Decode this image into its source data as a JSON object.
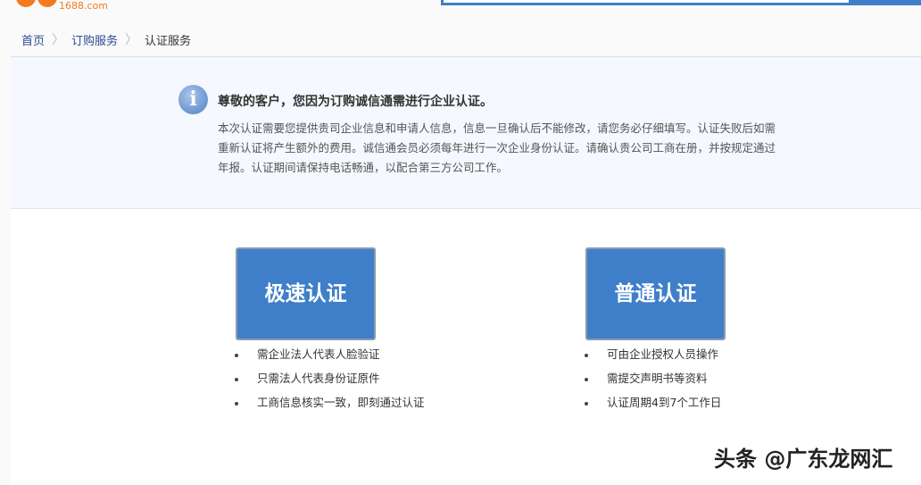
{
  "header": {
    "logo_text": "1688.com"
  },
  "breadcrumb": [
    "首页",
    "订购服务",
    "认证服务"
  ],
  "notice": {
    "title": "尊敬的客户，您因为订购诚信通需进行企业认证。",
    "body": "本次认证需要您提供贵司企业信息和申请人信息，信息一旦确认后不能修改，请您务必仔细填写。认证失败后如需重新认证将产生额外的费用。诚信通会员必须每年进行一次企业身份认证。请确认贵公司工商在册，并按规定通过年报。认证期间请保持电话畅通，以配合第三方公司工作。"
  },
  "options": [
    {
      "label": "极速认证",
      "features": [
        "需企业法人代表人脸验证",
        "只需法人代表身份证原件",
        "工商信息核实一致，即刻通过认证"
      ]
    },
    {
      "label": "普通认证",
      "features": [
        "可由企业授权人员操作",
        "需提交声明书等资料",
        "认证周期4到7个工作日"
      ]
    }
  ],
  "watermark": "头条 @广东龙网汇",
  "colors": {
    "accent": "#3f7fc9",
    "logo": "#f47a20"
  }
}
